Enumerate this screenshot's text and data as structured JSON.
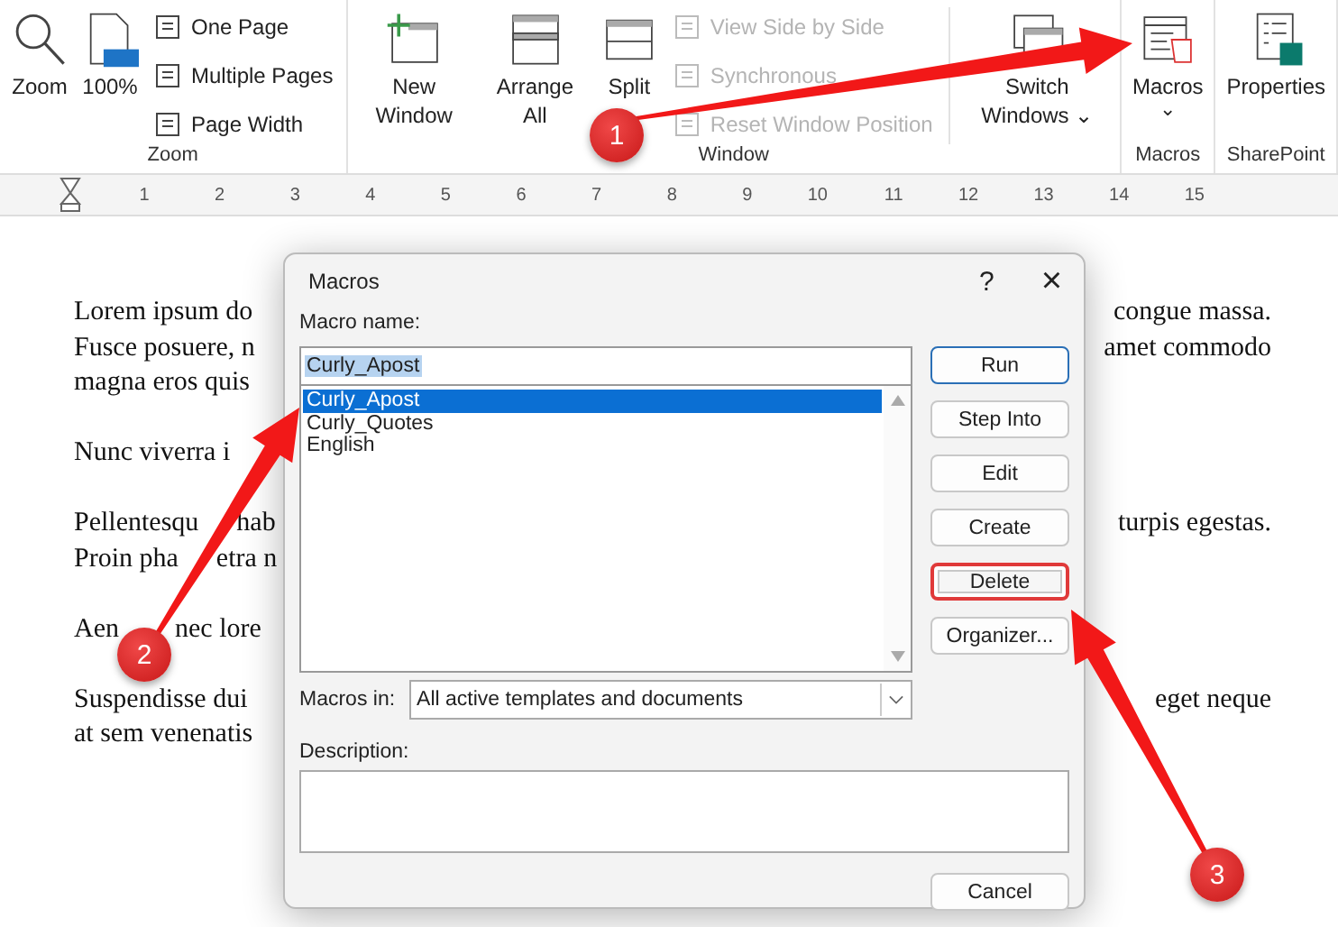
{
  "ribbon": {
    "groups": [
      {
        "label": "Zoom",
        "big": [
          {
            "label": "Zoom"
          },
          {
            "label": "100%"
          }
        ],
        "small": [
          {
            "label": "One Page",
            "disabled": false
          },
          {
            "label": "Multiple Pages",
            "disabled": false
          },
          {
            "label": "Page Width",
            "disabled": false
          }
        ]
      },
      {
        "label": "Window",
        "big": [
          {
            "label": "New Window"
          },
          {
            "label": "Arrange All"
          },
          {
            "label": "Split"
          }
        ],
        "small": [
          {
            "label": "View Side by Side",
            "disabled": true
          },
          {
            "label": "Synchronous",
            "disabled": true
          },
          {
            "label": "Reset Window Position",
            "disabled": true
          }
        ],
        "after": [
          {
            "label": "Switch Windows",
            "caret": "⌄"
          }
        ]
      },
      {
        "label": "Macros",
        "big": [
          {
            "label": "Macros",
            "caret": "⌄"
          }
        ]
      },
      {
        "label": "SharePoint",
        "big": [
          {
            "label": "Properties"
          }
        ]
      }
    ]
  },
  "ruler": {
    "marks": [
      "1",
      "2",
      "3",
      "4",
      "5",
      "6",
      "7",
      "8",
      "9",
      "10",
      "11",
      "12",
      "13",
      "14",
      "15"
    ]
  },
  "document": {
    "paragraphs": [
      [
        {
          "parts": [
            "Lorem ipsum do"
          ],
          "right": "congue massa."
        },
        {
          "parts": [
            "Fusce posuere, n"
          ],
          "right": "amet commodo"
        },
        {
          "parts": [
            "magna eros quis"
          ]
        }
      ],
      [
        {
          "parts": [
            "Nunc viverra i"
          ]
        }
      ],
      [
        {
          "parts": [
            "Pellentesqu",
            "hab"
          ],
          "right": "turpis egestas."
        },
        {
          "parts": [
            "Proin pha",
            "etra n"
          ]
        }
      ],
      [
        {
          "parts": [
            "Aen",
            "nec lore"
          ]
        }
      ],
      [
        {
          "parts": [
            "Suspendisse dui"
          ],
          "right": "eget neque"
        },
        {
          "parts": [
            "at sem venenatis"
          ]
        }
      ]
    ]
  },
  "dialog": {
    "title": "Macros",
    "help": "?",
    "close": "×",
    "name_label": "Macro name:",
    "name_value": "Curly_Apost",
    "macros": [
      {
        "name": "Curly_Apost",
        "selected": true
      },
      {
        "name": "Curly_Quotes",
        "selected": false
      },
      {
        "name": "English",
        "selected": false
      }
    ],
    "buttons": [
      {
        "label": "Run",
        "default": true,
        "highlighted": false
      },
      {
        "label": "Step Into",
        "default": false,
        "highlighted": false
      },
      {
        "label": "Edit",
        "default": false,
        "highlighted": false
      },
      {
        "label": "Create",
        "default": false,
        "highlighted": false
      },
      {
        "label": "Delete",
        "default": false,
        "highlighted": true
      },
      {
        "label": "Organizer...",
        "default": false,
        "highlighted": false
      }
    ],
    "macros_in_label": "Macros in:",
    "macros_in_value": "All active templates and documents",
    "description_label": "Description:",
    "cancel": "Cancel"
  },
  "callouts": [
    {
      "number": "1"
    },
    {
      "number": "2"
    },
    {
      "number": "3"
    }
  ]
}
